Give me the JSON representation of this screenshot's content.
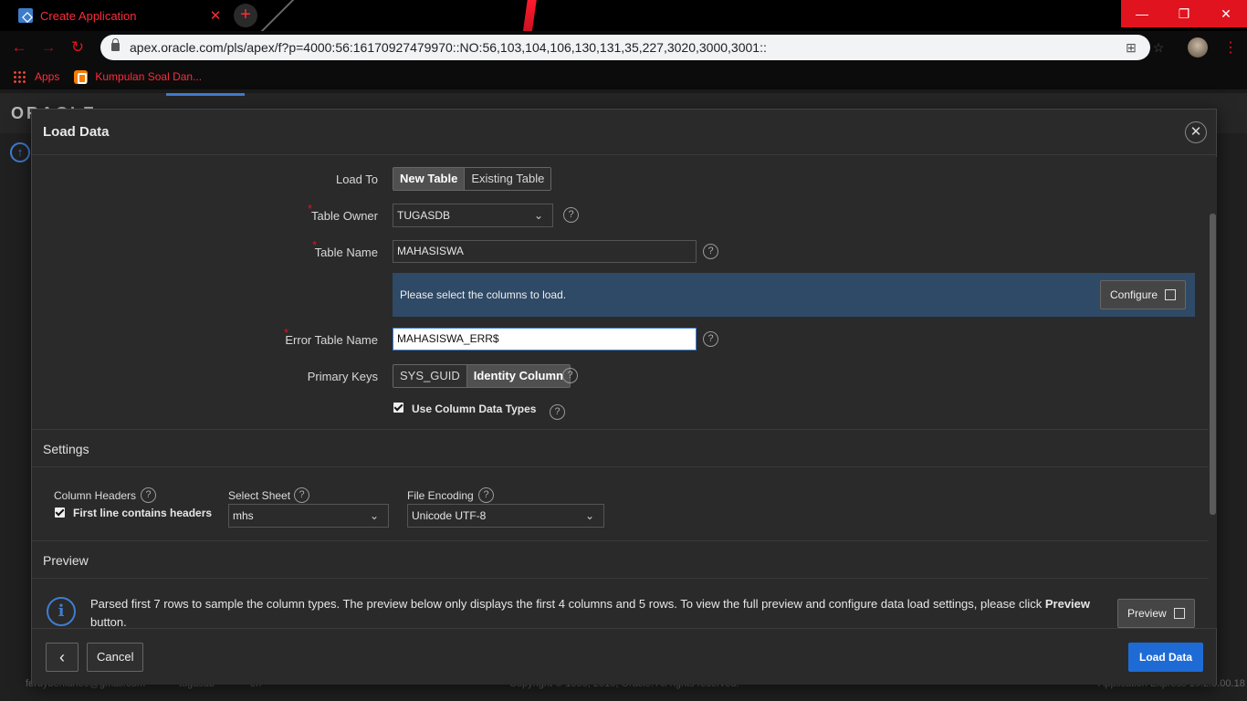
{
  "browser": {
    "tab_title": "Create Application",
    "url": "apex.oracle.com/pls/apex/f?p=4000:56:16170927479970::NO:56,103,104,106,130,131,35,227,3020,3000,3001::",
    "bookmarks": [
      "Apps",
      "Kumpulan Soal Dan..."
    ]
  },
  "background": {
    "logo": "ORACLE",
    "footer_user": "ferdyberlian00@gmail.com",
    "footer_schema": "tugasdb",
    "footer_lang": "en",
    "footer_copyright": "Copyright © 1999, 2019, Oracle. All rights reserved.",
    "footer_version": "Application Express 19.2.0.00.18"
  },
  "dialog": {
    "title": "Load Data",
    "load_to": {
      "label": "Load To",
      "options": [
        "New Table",
        "Existing Table"
      ],
      "selected": "New Table"
    },
    "table_owner": {
      "label": "Table Owner",
      "value": "TUGASDB"
    },
    "table_name": {
      "label": "Table Name",
      "value": "MAHASISWA"
    },
    "columns_info": {
      "message": "Please select the columns to load.",
      "button": "Configure"
    },
    "error_table": {
      "label": "Error Table Name",
      "value": "MAHASISWA_ERR$"
    },
    "primary_keys": {
      "label": "Primary Keys",
      "options": [
        "SYS_GUID",
        "Identity Column"
      ],
      "selected": "Identity Column"
    },
    "use_column_types": {
      "label": "Use Column Data Types",
      "checked": true
    },
    "settings": {
      "heading": "Settings",
      "column_headers": {
        "label": "Column Headers",
        "checkbox_label": "First line contains headers",
        "checked": true
      },
      "select_sheet": {
        "label": "Select Sheet",
        "value": "mhs"
      },
      "file_encoding": {
        "label": "File Encoding",
        "value": "Unicode UTF-8"
      }
    },
    "preview": {
      "heading": "Preview",
      "message_part1": "Parsed first 7 rows to sample the column types. The preview below only displays the first 4 columns and 5 rows. To view the full preview and configure data load settings, please",
      "message_part2": "click",
      "message_bold": "Preview",
      "message_part3": "button.",
      "button": "Preview"
    },
    "footer": {
      "back": "‹",
      "cancel": "Cancel",
      "load": "Load Data"
    }
  }
}
